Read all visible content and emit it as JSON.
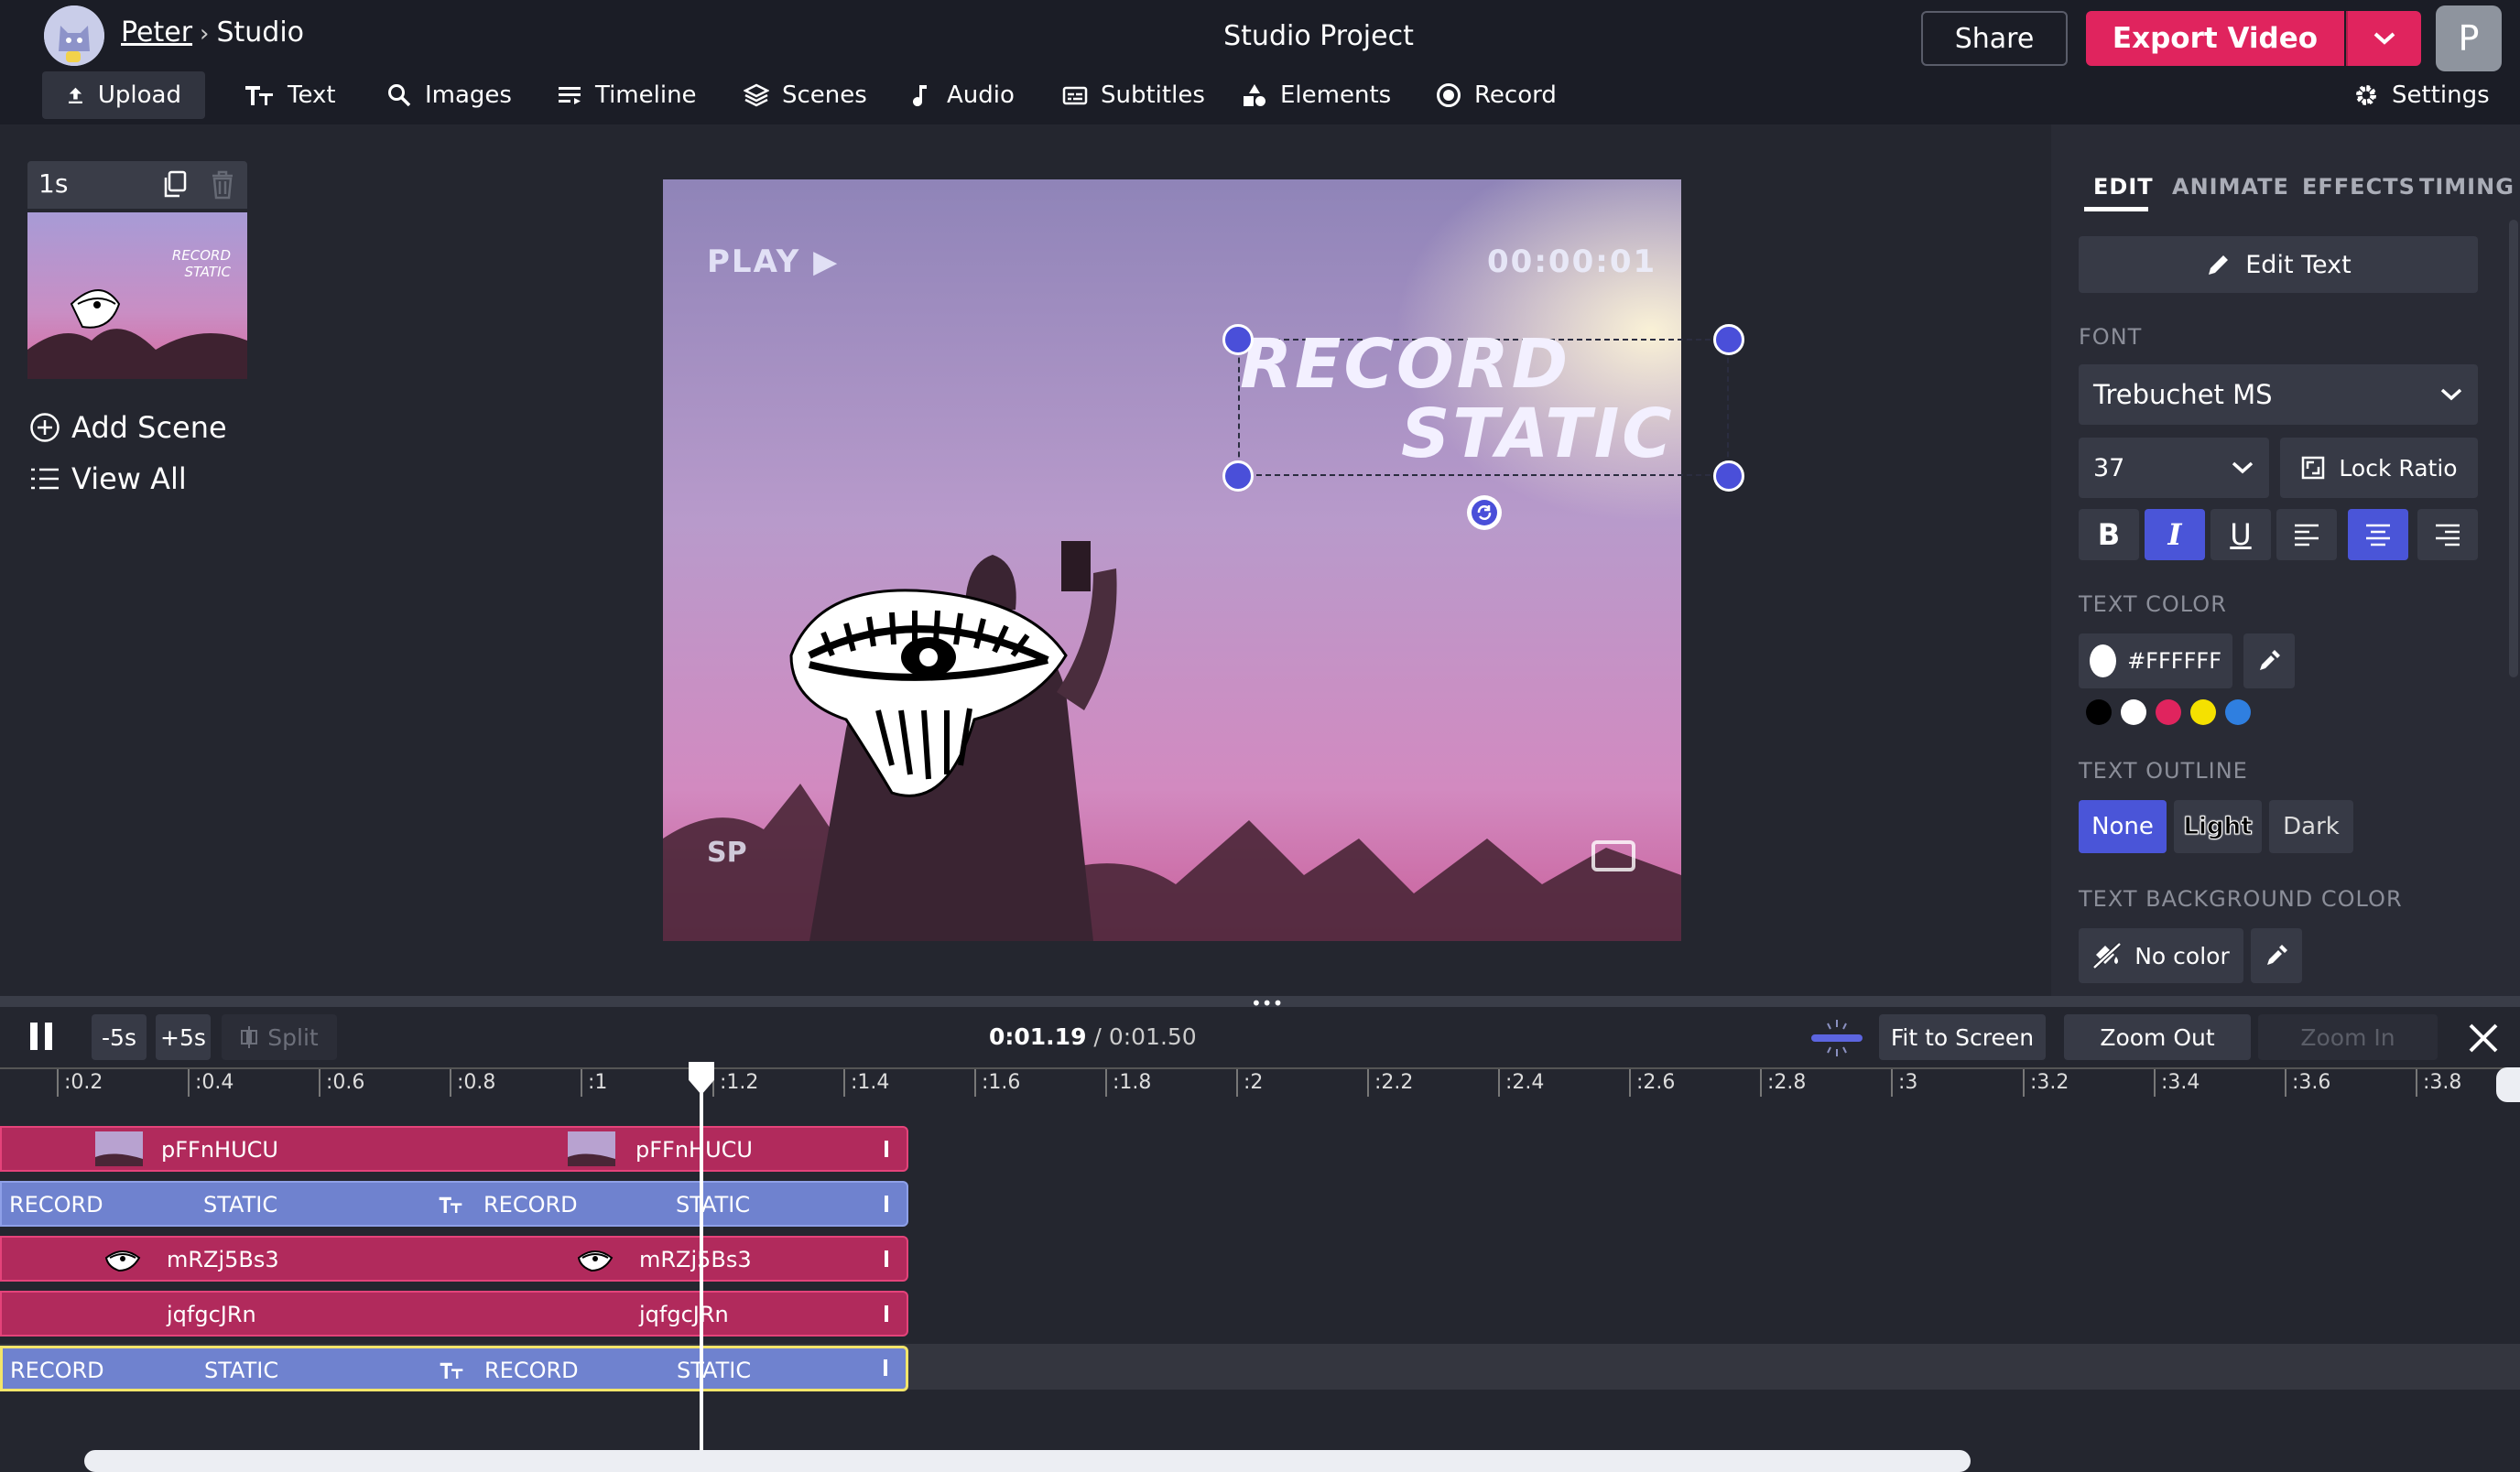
{
  "header": {
    "user_link": "Peter",
    "breadcrumb_sep": "›",
    "section": "Studio",
    "project_title": "Studio Project",
    "share_label": "Share",
    "export_label": "Export Video",
    "user_initial": "P"
  },
  "toolbar": {
    "items": [
      {
        "label": "Upload",
        "icon": "upload-icon"
      },
      {
        "label": "Text",
        "icon": "text-icon"
      },
      {
        "label": "Images",
        "icon": "search-icon"
      },
      {
        "label": "Timeline",
        "icon": "timeline-icon"
      },
      {
        "label": "Scenes",
        "icon": "layers-icon"
      },
      {
        "label": "Audio",
        "icon": "music-note-icon"
      },
      {
        "label": "Subtitles",
        "icon": "subtitles-icon"
      },
      {
        "label": "Elements",
        "icon": "shapes-icon"
      },
      {
        "label": "Record",
        "icon": "record-icon"
      }
    ],
    "settings_label": "Settings"
  },
  "scenes": {
    "duration": "1s",
    "add_scene": "Add Scene",
    "view_all": "View All"
  },
  "canvas": {
    "overlay_play": "PLAY ▶",
    "overlay_time": "00:00:01",
    "overlay_sp": "SP",
    "text_line1": "RECORD",
    "text_line2": "STATIC"
  },
  "right_panel": {
    "tabs": [
      "EDIT",
      "ANIMATE",
      "EFFECTS",
      "TIMING"
    ],
    "edit_text": "Edit Text",
    "font_label": "FONT",
    "font_value": "Trebuchet MS",
    "size_value": "37",
    "lock_ratio": "Lock Ratio",
    "text_color_label": "TEXT COLOR",
    "text_color_value": "#FFFFFF",
    "swatches": [
      "#000000",
      "#ffffff",
      "#e0245e",
      "#f5e100",
      "#2f7fe0"
    ],
    "outline_label": "TEXT OUTLINE",
    "outline_none": "None",
    "outline_light": "Light",
    "outline_dark": "Dark",
    "bg_color_label": "TEXT BACKGROUND COLOR",
    "bg_no_color": "No color"
  },
  "timeline": {
    "back5": "-5s",
    "fwd5": "+5s",
    "split": "Split",
    "current_time": "0:01.19",
    "time_sep": " / ",
    "total_time": "0:01.50",
    "fit_to_screen": "Fit to Screen",
    "zoom_out": "Zoom Out",
    "zoom_in": "Zoom In",
    "ticks": [
      ":0.2",
      ":0.4",
      ":0.6",
      ":0.8",
      ":1",
      ":1.2",
      ":1.4",
      ":1.6",
      ":1.8",
      ":2",
      ":2.2",
      ":2.4",
      ":2.6",
      ":2.8",
      ":3",
      ":3.2",
      ":3.4",
      ":3.6",
      ":3.8"
    ],
    "tracks": [
      {
        "type": "media",
        "labels": [
          "pFFnHUCU",
          "pFFnHUCU"
        ]
      },
      {
        "type": "text",
        "labels": [
          "RECORD",
          "STATIC",
          "RECORD",
          "STATIC"
        ]
      },
      {
        "type": "media",
        "labels": [
          "mRZj5Bs3",
          "mRZj5Bs3"
        ]
      },
      {
        "type": "media",
        "labels": [
          "jqfgcJRn",
          "jqfgcJRn"
        ]
      },
      {
        "type": "text",
        "labels": [
          "RECORD",
          "STATIC",
          "RECORD",
          "STATIC"
        ]
      }
    ]
  }
}
